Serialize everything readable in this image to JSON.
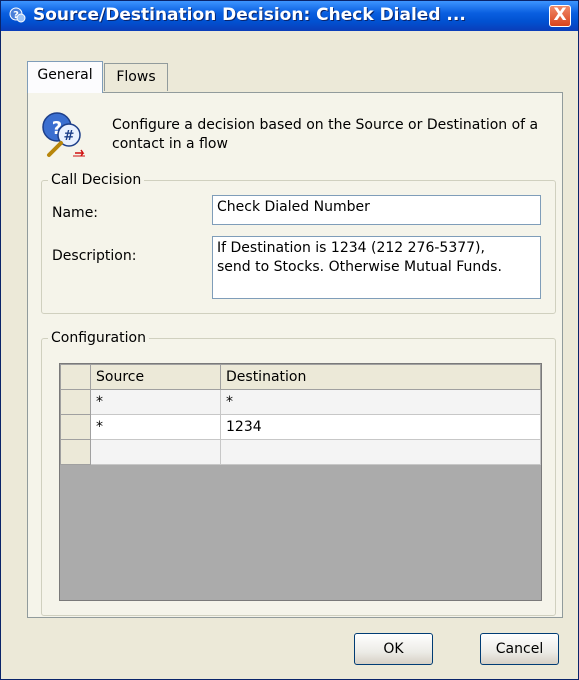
{
  "window": {
    "title": "Source/Destination Decision: Check Dialed ...",
    "close_glyph": "X",
    "accent_color": "#0150d0",
    "close_color": "#d9431c"
  },
  "tabs": [
    {
      "label": "General",
      "active": true
    },
    {
      "label": "Flows",
      "active": false
    }
  ],
  "intro": {
    "icon": "decision-icon",
    "text": "Configure a decision based on the Source or Destination of a contact in a flow"
  },
  "call_decision": {
    "legend": "Call Decision",
    "name_label": "Name:",
    "name_value": "Check Dialed Number",
    "description_label": "Description:",
    "description_line1": "If Destination is 1234 (212 276-5377),",
    "description_line2": "send to Stocks.  Otherwise Mutual Funds."
  },
  "configuration": {
    "legend": "Configuration",
    "columns": [
      "Source",
      "Destination"
    ],
    "rows": [
      [
        "*",
        "*"
      ],
      [
        "*",
        "1234"
      ],
      [
        "",
        ""
      ]
    ]
  },
  "buttons": {
    "ok": "OK",
    "cancel": "Cancel"
  }
}
